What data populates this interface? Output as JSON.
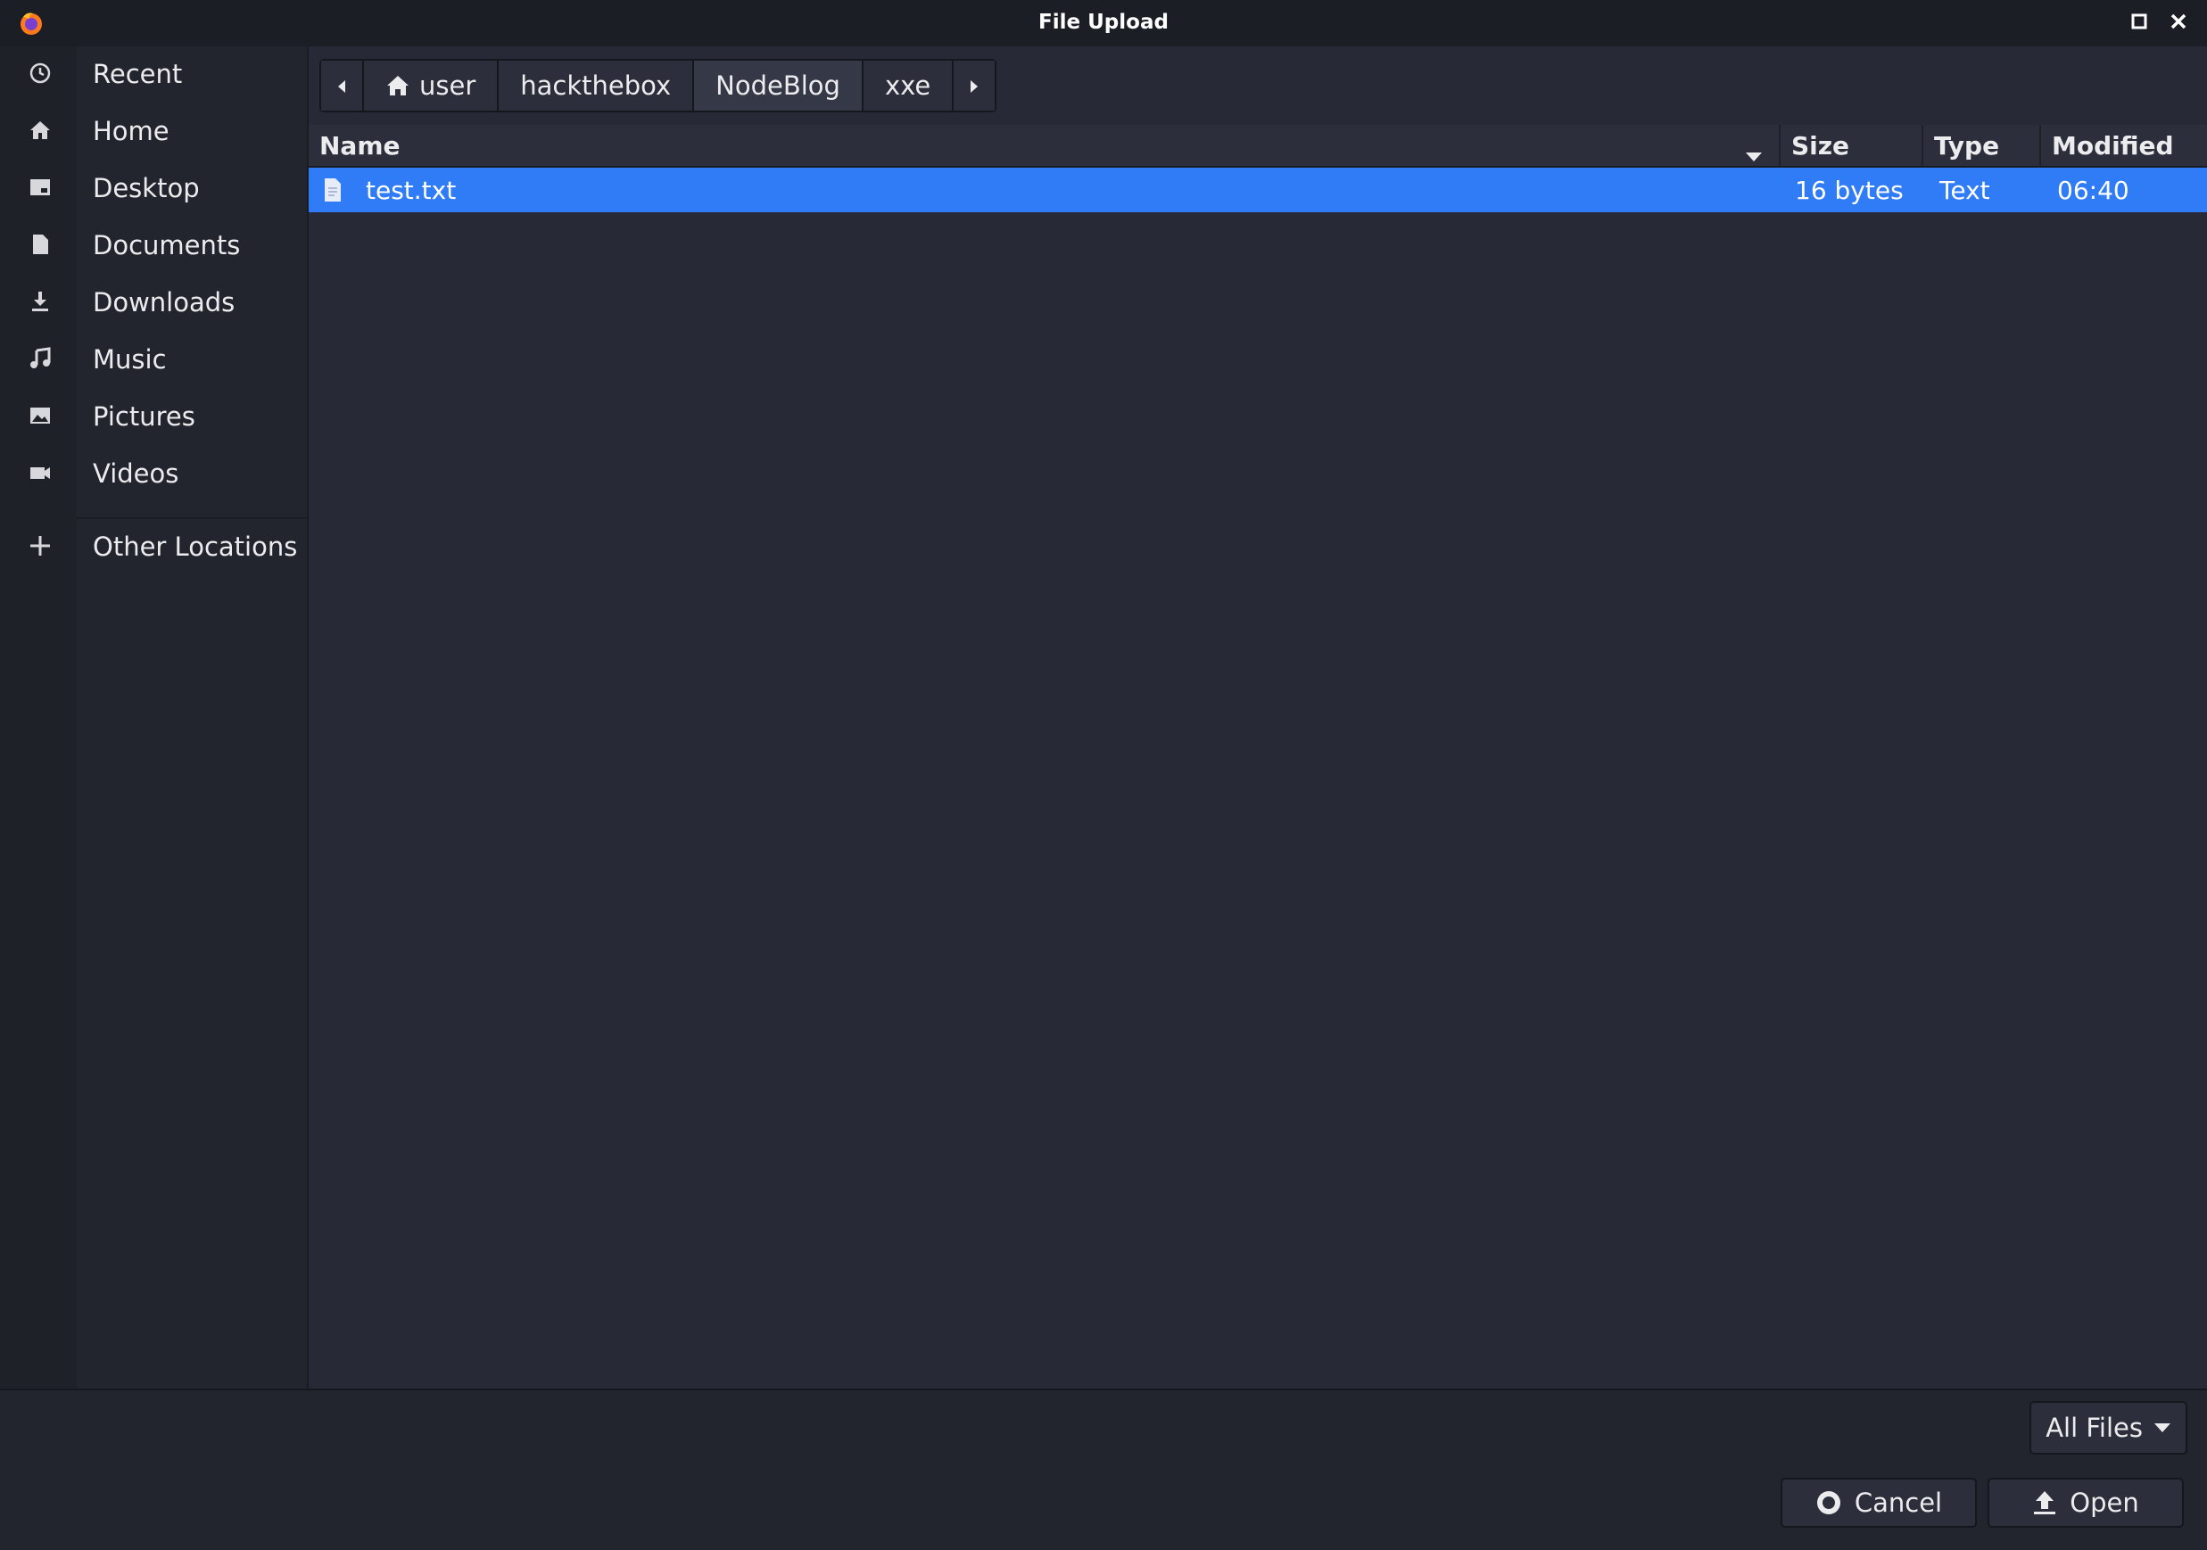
{
  "window": {
    "title": "File Upload",
    "app_icon": "firefox-icon",
    "controls": [
      "maximize-icon",
      "close-icon"
    ]
  },
  "sidebar": {
    "items": [
      {
        "label": "Recent",
        "icon": "clock-icon"
      },
      {
        "label": "Home",
        "icon": "home-icon"
      },
      {
        "label": "Desktop",
        "icon": "desktop-icon"
      },
      {
        "label": "Documents",
        "icon": "document-icon"
      },
      {
        "label": "Downloads",
        "icon": "download-icon"
      },
      {
        "label": "Music",
        "icon": "music-icon"
      },
      {
        "label": "Pictures",
        "icon": "picture-icon"
      },
      {
        "label": "Videos",
        "icon": "video-icon"
      }
    ],
    "other": {
      "label": "Other Locations",
      "icon": "plus-icon"
    }
  },
  "pathbar": {
    "crumbs": [
      "user",
      "hackthebox",
      "NodeBlog",
      "xxe"
    ]
  },
  "columns": {
    "name": "Name",
    "size": "Size",
    "type": "Type",
    "modified": "Modified"
  },
  "files": [
    {
      "name": "test.txt",
      "size": "16 bytes",
      "type": "Text",
      "modified": "06:40",
      "selected": true
    }
  ],
  "filter": {
    "label": "All Files"
  },
  "buttons": {
    "cancel": "Cancel",
    "open": "Open"
  },
  "colors": {
    "selection": "#2f7cf6",
    "background": "#272a36",
    "titlebar": "#1c1e26"
  }
}
